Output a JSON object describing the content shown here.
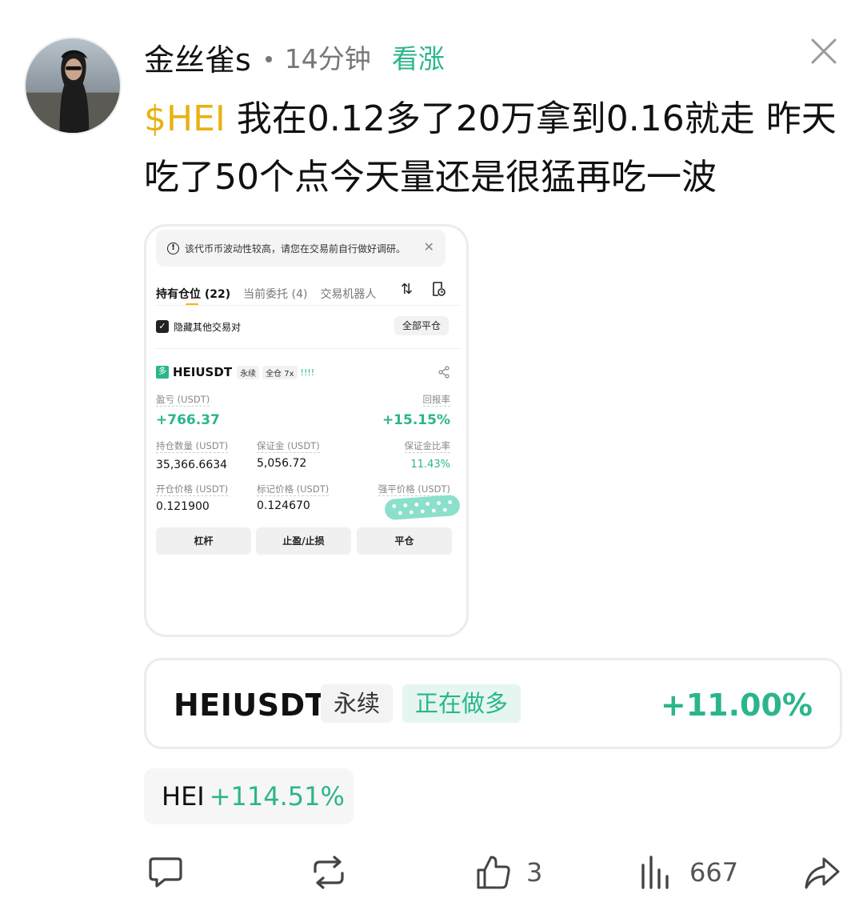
{
  "author": {
    "name": "金丝雀s",
    "time": "14分钟",
    "sentiment": "看涨"
  },
  "post": {
    "ticker": "$HEI",
    "text": " 我在0.12多了20万拿到0.16就走 昨天吃了50个点今天量还是很猛再吃一波"
  },
  "screenshot": {
    "warning": "该代币币波动性较高，请您在交易前自行做好调研。",
    "tabs": [
      {
        "label": "持有仓位 (22)"
      },
      {
        "label": "当前委托 (4)"
      },
      {
        "label": "交易机器人"
      }
    ],
    "hide_other_pairs": "隐藏其他交易对",
    "close_all": "全部平仓",
    "pair": {
      "badge": "多",
      "symbol": "HEIUSDT",
      "type": "永续",
      "margin": "全仓 7x",
      "bars": "!!!!"
    },
    "pnl_label": "盈亏 (USDT)",
    "pnl_value": "+766.37",
    "roi_label": "回报率",
    "roi_value": "+15.15%",
    "size_label": "持仓数量 (USDT)",
    "size_value": "35,366.6634",
    "margin_label": "保证金 (USDT)",
    "margin_value": "5,056.72",
    "margin_ratio_label": "保证金比率",
    "margin_ratio_value": "11.43%",
    "entry_label": "开仓价格 (USDT)",
    "entry_value": "0.121900",
    "mark_label": "标记价格 (USDT)",
    "mark_value": "0.124670",
    "liq_label": "强平价格 (USDT)",
    "buttons": {
      "leverage": "杠杆",
      "tp_sl": "止盈/止损",
      "close": "平仓"
    }
  },
  "position_card": {
    "symbol": "HEIUSDT",
    "type": "永续",
    "direction": "正在做多",
    "change": "+11.00%"
  },
  "coin_chip": {
    "symbol": "HEI",
    "change": "+114.51%"
  },
  "actions": {
    "likes": "3",
    "views": "667"
  },
  "colors": {
    "green": "#2bb58d",
    "gold": "#e8b211"
  }
}
